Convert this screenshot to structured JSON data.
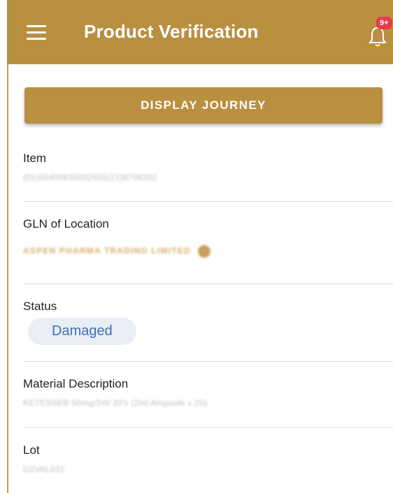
{
  "header": {
    "title": "Product Verification",
    "notification_badge": "9+",
    "menu_icon": "hamburger-icon",
    "notification_icon": "bell-icon",
    "color": "#b98f40"
  },
  "actions": {
    "display_journey_label": "DISPLAY JOURNEY"
  },
  "fields": {
    "item": {
      "label": "Item",
      "value": "(01)05400835002555(21)8706202"
    },
    "gln": {
      "label": "GLN of Location",
      "value": "ASPEN PHARMA TRADING LIMITED"
    },
    "status": {
      "label": "Status",
      "value": "Damaged",
      "chip_color": "#e9eef6",
      "text_color": "#3d6fb6"
    },
    "material": {
      "label": "Material Description",
      "value": "KETESSEB 50mg/2ml 20's (2ml Ampoule x 20)"
    },
    "lot": {
      "label": "Lot",
      "value": "D2VAL031"
    }
  }
}
